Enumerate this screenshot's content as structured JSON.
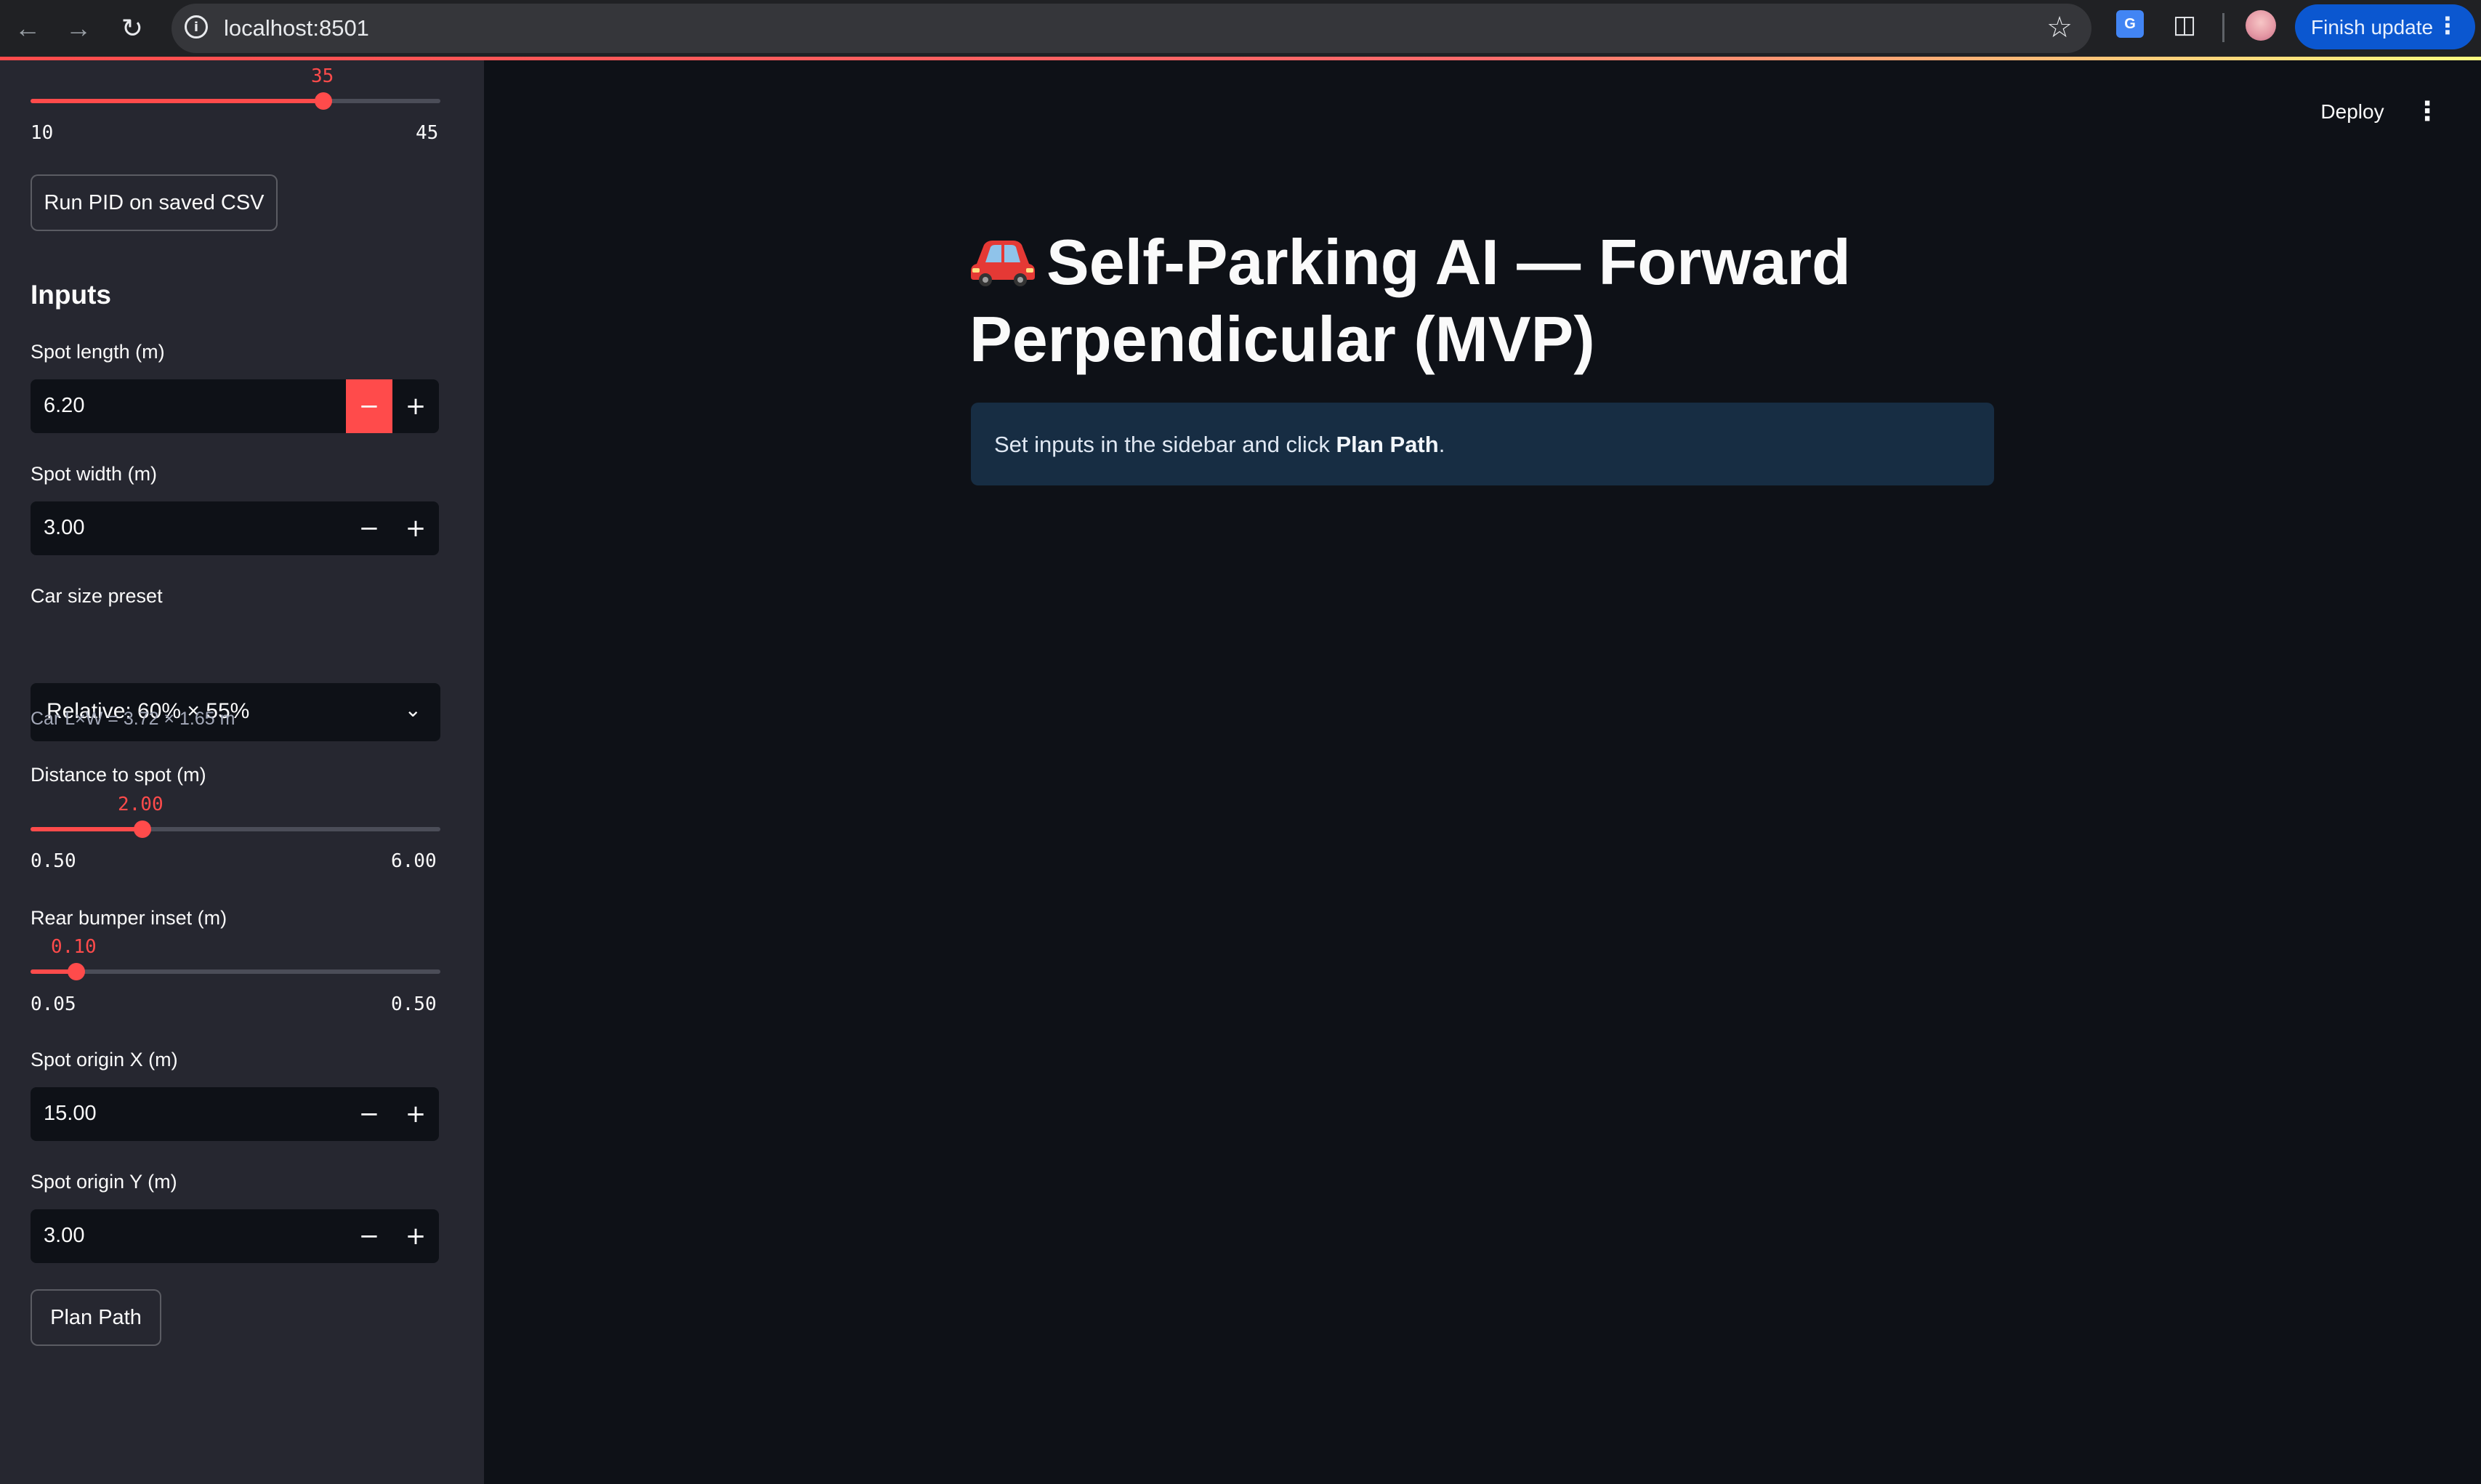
{
  "browser": {
    "url": "localhost:8501",
    "finish_update_label": "Finish update",
    "back_icon": "arrow-left",
    "forward_icon": "arrow-right",
    "reload_icon": "reload",
    "info_icon": "info-circle",
    "star_icon": "star-outline",
    "menu_icon": "vertical-dots"
  },
  "sidebar": {
    "top_slider": {
      "value": "35",
      "min_label": "10",
      "max_label": "45",
      "fraction": 0.714
    },
    "run_pid_button": "Run PID on saved CSV",
    "inputs_heading": "Inputs",
    "spot_length": {
      "label": "Spot length (m)",
      "value": "6.20"
    },
    "spot_width": {
      "label": "Spot width (m)",
      "value": "3.00"
    },
    "car_size": {
      "label": "Car size preset",
      "selected": "Relative: 60% × 55%"
    },
    "car_dims_caption": "Car L×W = 3.72 × 1.65 m",
    "distance_slider": {
      "label": "Distance to spot (m)",
      "value": "2.00",
      "min_label": "0.50",
      "max_label": "6.00",
      "fraction": 0.273
    },
    "rear_slider": {
      "label": "Rear bumper inset (m)",
      "value": "0.10",
      "min_label": "0.05",
      "max_label": "0.50",
      "fraction": 0.111
    },
    "spot_origin_x": {
      "label": "Spot origin X (m)",
      "value": "15.00"
    },
    "spot_origin_y": {
      "label": "Spot origin Y (m)",
      "value": "3.00"
    },
    "plan_path_button": "Plan Path",
    "stepper": {
      "minus": "−",
      "plus": "+"
    }
  },
  "main": {
    "deploy_label": "Deploy",
    "title": "Self-Parking AI — Forward Perpendicular (MVP)",
    "title_emoji": "red-car",
    "info_text_prefix": "Set inputs in the sidebar and click ",
    "info_text_bold": "Plan Path",
    "info_text_suffix": "."
  },
  "colors": {
    "accent": "#ff4b4b",
    "sidebar_bg": "#262730",
    "main_bg": "#0e1117",
    "info_bg": "#172d43"
  }
}
